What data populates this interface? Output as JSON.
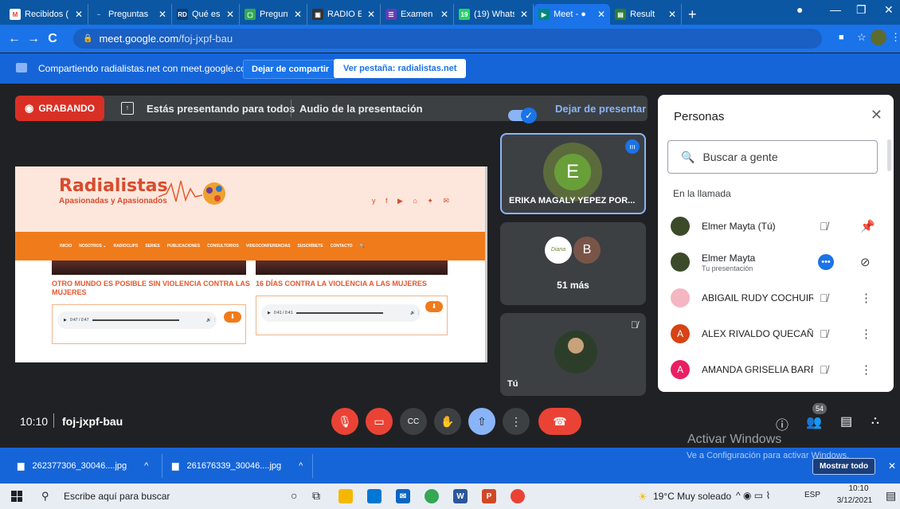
{
  "browser": {
    "tabs": [
      {
        "label": "Recibidos (",
        "fav": "M",
        "fav_color": "#ffffff",
        "fav_text": "#ea4335"
      },
      {
        "label": "Preguntas",
        "fav": "~",
        "fav_color": "#0b57a4",
        "fav_text": "#8ab4f8"
      },
      {
        "label": "Qué es un",
        "fav": "RD",
        "fav_color": "#0b3d7a",
        "fav_text": "#ffffff"
      },
      {
        "label": "Preguntas",
        "fav": "▢",
        "fav_color": "#34a853",
        "fav_text": "#ffffff"
      },
      {
        "label": "RADIO EDI",
        "fav": "▣",
        "fav_color": "#333333",
        "fav_text": "#ffffff"
      },
      {
        "label": "Examen - F",
        "fav": "☰",
        "fav_color": "#673ab7",
        "fav_text": "#ffffff"
      },
      {
        "label": "(19) Whats",
        "fav": "19",
        "fav_color": "#25d366",
        "fav_text": "#ffffff"
      },
      {
        "label": "Meet - ●",
        "fav": "▶",
        "fav_color": "#00897b",
        "fav_text": "#ffffff"
      },
      {
        "label": "Result",
        "fav": "▤",
        "fav_color": "#2e7d32",
        "fav_text": "#ffffff"
      }
    ],
    "new_tab": "+",
    "url_domain": "meet.google.com",
    "url_path": "/foj-jxpf-bau"
  },
  "share_bar": {
    "text": "Compartiendo radialistas.net con meet.google.com",
    "stop_label": "Dejar de compartir",
    "view_label": "Ver pestaña: radialistas.net"
  },
  "recording": {
    "badge": "GRABANDO",
    "presenting": "Estás presentando para todos",
    "audio": "Audio de la presentación",
    "stop_presenting": "Dejar de presentar"
  },
  "site": {
    "logo": "Radialistas",
    "tagline": "Apasionadas y Apasionados",
    "social": "y f ▶ ⌂ ✦ ✉",
    "nav": [
      "INICIO",
      "NOSOTROS ⌄",
      "RADIOCLIPS",
      "SERIES",
      "PUBLICACIONES",
      "CONSULTORIOS",
      "VIDEOCONFERENCIAS",
      "SUSCRÍBETE",
      "CONTACTO",
      "🔍"
    ],
    "articles": [
      {
        "title": "OTRO MUNDO ES POSIBLE SIN VIOLENCIA CONTRA LAS MUJERES",
        "time": "0:47 / 0:47"
      },
      {
        "title": "16 DÍAS CONTRA LA VIOLENCIA A LAS MUJERES",
        "time": "0:41 / 0:41"
      }
    ]
  },
  "tiles": {
    "speaker_initial": "E",
    "speaker_name": "ERIKA MAGALY YEPEZ POR...",
    "group_initial": "B",
    "group_avatar_text": "Diana",
    "more": "51 más",
    "self_name": "Tú"
  },
  "people": {
    "title": "Personas",
    "search_placeholder": "Buscar a gente",
    "section": "En la llamada",
    "rows": [
      {
        "name": "Elmer Mayta (Tú)",
        "sub": "",
        "avatar": "",
        "color": "#3d4a2a"
      },
      {
        "name": "Elmer Mayta",
        "sub": "Tu presentación",
        "avatar": "",
        "color": "#3d4a2a"
      },
      {
        "name": "ABIGAIL RUDY COCHUIR...",
        "sub": "",
        "avatar": "",
        "color": "#f4b6c2"
      },
      {
        "name": "ALEX RIVALDO QUECAÑ...",
        "sub": "",
        "avatar": "A",
        "color": "#d84315"
      },
      {
        "name": "AMANDA GRISELIA BARR...",
        "sub": "",
        "avatar": "A",
        "color": "#e91e63"
      }
    ]
  },
  "meeting": {
    "time": "10:10",
    "code": "foj-jxpf-bau",
    "participants": "54"
  },
  "downloads": {
    "files": [
      "262377306_30046....jpg",
      "261676339_30046....jpg"
    ],
    "show_all": "Mostrar todo"
  },
  "watermark": {
    "title": "Activar Windows",
    "sub": "Ve a Configuración para activar Windows."
  },
  "taskbar": {
    "search": "Escribe aquí para buscar",
    "weather": "19°C  Muy soleado",
    "lang": "ESP",
    "time": "10:10",
    "date": "3/12/2021"
  }
}
